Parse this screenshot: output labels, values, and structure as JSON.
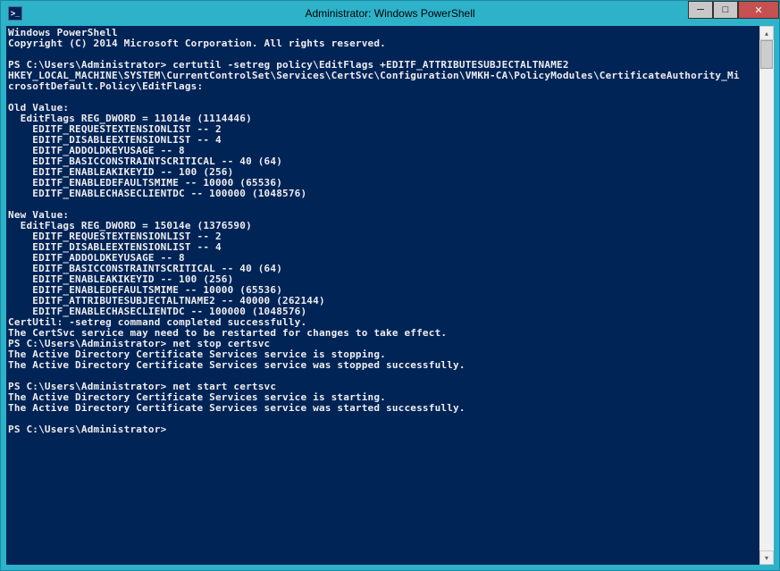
{
  "window": {
    "title": "Administrator: Windows PowerShell",
    "icon_glyph": ">_"
  },
  "controls": {
    "minimize_glyph": "─",
    "maximize_glyph": "□",
    "close_glyph": "✕"
  },
  "scrollbar": {
    "up_glyph": "▴",
    "down_glyph": "▾"
  },
  "terminal": {
    "lines": [
      "Windows PowerShell",
      "Copyright (C) 2014 Microsoft Corporation. All rights reserved.",
      "",
      "PS C:\\Users\\Administrator> certutil -setreg policy\\EditFlags +EDITF_ATTRIBUTESUBJECTALTNAME2",
      "HKEY_LOCAL_MACHINE\\SYSTEM\\CurrentControlSet\\Services\\CertSvc\\Configuration\\VMKH-CA\\PolicyModules\\CertificateAuthority_Mi",
      "crosoftDefault.Policy\\EditFlags:",
      "",
      "Old Value:",
      "  EditFlags REG_DWORD = 11014e (1114446)",
      "    EDITF_REQUESTEXTENSIONLIST -- 2",
      "    EDITF_DISABLEEXTENSIONLIST -- 4",
      "    EDITF_ADDOLDKEYUSAGE -- 8",
      "    EDITF_BASICCONSTRAINTSCRITICAL -- 40 (64)",
      "    EDITF_ENABLEAKIKEYID -- 100 (256)",
      "    EDITF_ENABLEDEFAULTSMIME -- 10000 (65536)",
      "    EDITF_ENABLECHASECLIENTDC -- 100000 (1048576)",
      "",
      "New Value:",
      "  EditFlags REG_DWORD = 15014e (1376590)",
      "    EDITF_REQUESTEXTENSIONLIST -- 2",
      "    EDITF_DISABLEEXTENSIONLIST -- 4",
      "    EDITF_ADDOLDKEYUSAGE -- 8",
      "    EDITF_BASICCONSTRAINTSCRITICAL -- 40 (64)",
      "    EDITF_ENABLEAKIKEYID -- 100 (256)",
      "    EDITF_ENABLEDEFAULTSMIME -- 10000 (65536)",
      "    EDITF_ATTRIBUTESUBJECTALTNAME2 -- 40000 (262144)",
      "    EDITF_ENABLECHASECLIENTDC -- 100000 (1048576)",
      "CertUtil: -setreg command completed successfully.",
      "The CertSvc service may need to be restarted for changes to take effect.",
      "PS C:\\Users\\Administrator> net stop certsvc",
      "The Active Directory Certificate Services service is stopping.",
      "The Active Directory Certificate Services service was stopped successfully.",
      "",
      "PS C:\\Users\\Administrator> net start certsvc",
      "The Active Directory Certificate Services service is starting.",
      "The Active Directory Certificate Services service was started successfully.",
      "",
      "PS C:\\Users\\Administrator>"
    ]
  }
}
